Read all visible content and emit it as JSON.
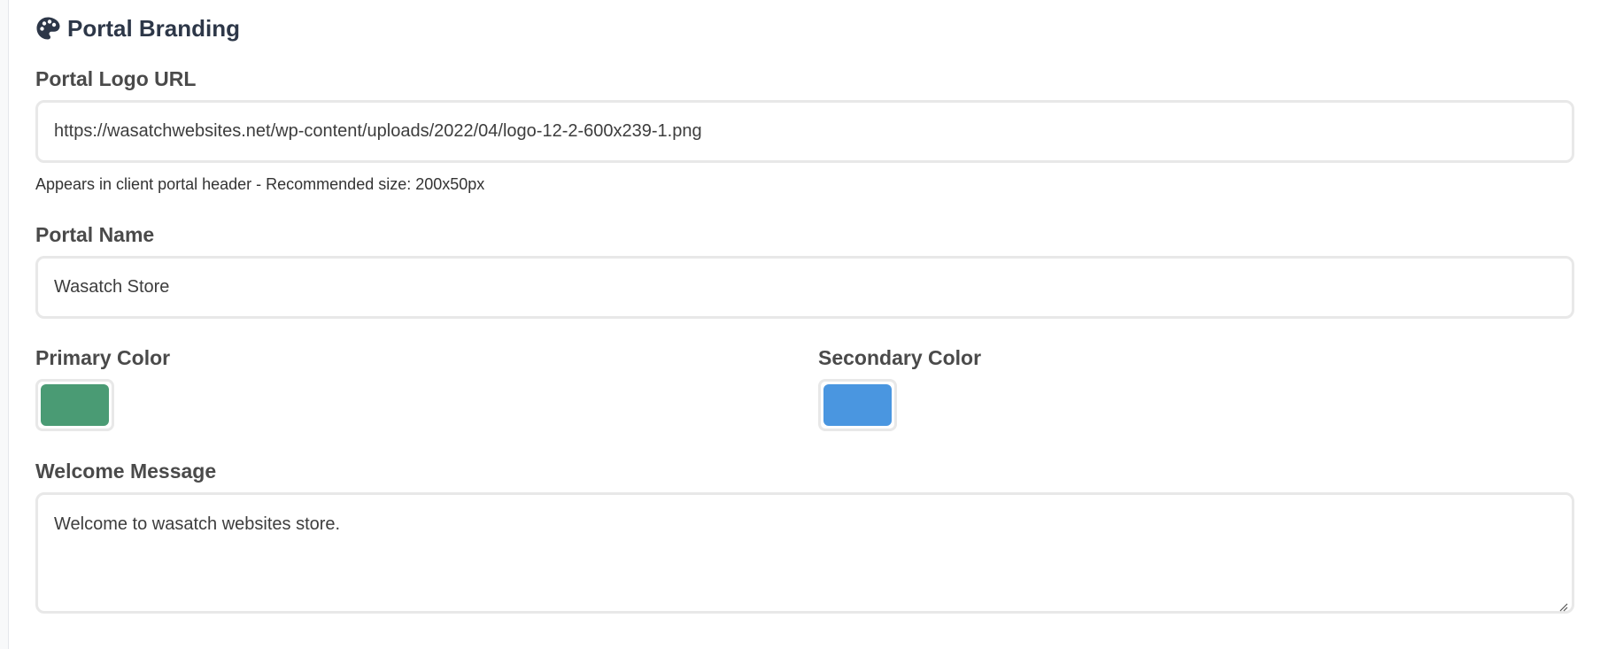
{
  "section": {
    "title": "Portal Branding",
    "icon": "palette-icon"
  },
  "logo_url": {
    "label": "Portal Logo URL",
    "value": "https://wasatchwebsites.net/wp-content/uploads/2022/04/logo-12-2-600x239-1.png",
    "help": "Appears in client portal header - Recommended size: 200x50px"
  },
  "portal_name": {
    "label": "Portal Name",
    "value": "Wasatch Store"
  },
  "primary_color": {
    "label": "Primary Color",
    "value": "#4a9b74"
  },
  "secondary_color": {
    "label": "Secondary Color",
    "value": "#4a96e0"
  },
  "welcome_message": {
    "label": "Welcome Message",
    "value": "Welcome to wasatch websites store."
  }
}
